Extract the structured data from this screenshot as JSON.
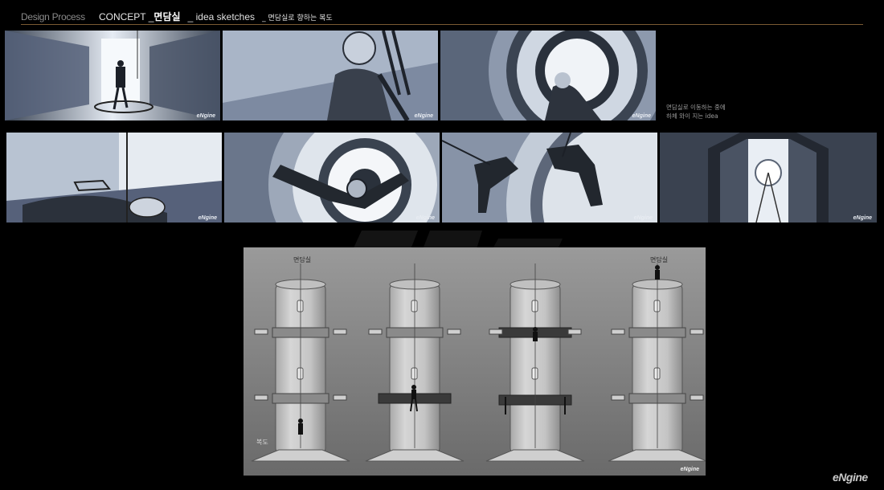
{
  "header": {
    "process": "Design Process",
    "concept": "CONCEPT _",
    "room": "면담실",
    "idea": "_ idea sketches",
    "corridor": "_ 면담실로 향하는 복도"
  },
  "panel_watermark": "eNgine",
  "side_note": {
    "line1": "면담실로 이동하는 중에",
    "line2": "하체 와이 지는 idea"
  },
  "diagram": {
    "label_top_left": "면담실",
    "label_top_right": "면담실",
    "label_bottom_left": "복도",
    "watermark": "eNgine"
  },
  "logo": "eNgine",
  "colors": {
    "accent_rule": "#7a5a33",
    "panel_blue": "#7f8ea6",
    "diagram_gray": "#8f8f8f"
  }
}
